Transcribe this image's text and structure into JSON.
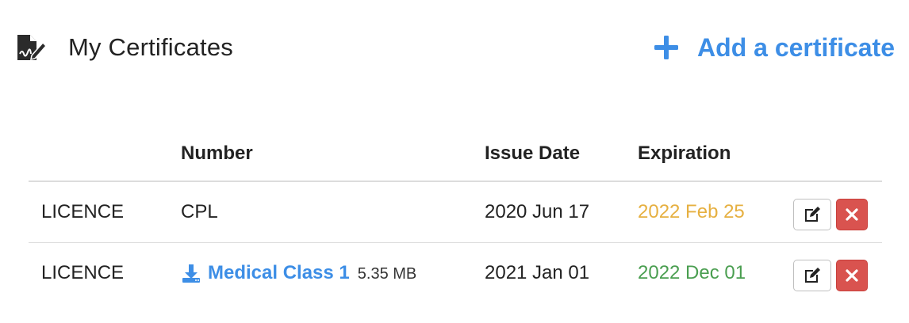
{
  "header": {
    "title": "My Certificates",
    "title_icon": "file-signature-icon",
    "add_label": "Add a certificate",
    "add_icon": "plus-icon"
  },
  "table": {
    "columns": [
      "",
      "Number",
      "Issue Date",
      "Expiration",
      ""
    ],
    "rows": [
      {
        "type": "LICENCE",
        "number": "CPL",
        "file": null,
        "issue_date": "2020 Jun 17",
        "expiration": "2022 Feb 25",
        "expiration_status": "warning"
      },
      {
        "type": "LICENCE",
        "number": "Medical Class 1",
        "file_icon": "download-icon",
        "file_size": "5.35 MB",
        "issue_date": "2021 Jan 01",
        "expiration": "2022 Dec 01",
        "expiration_status": "ok"
      }
    ]
  },
  "colors": {
    "accent": "#3d8ee6",
    "warning": "#e6b041",
    "ok": "#4a9e50",
    "danger": "#d9534f"
  },
  "icons": {
    "edit": "edit-icon",
    "delete": "close-icon"
  }
}
